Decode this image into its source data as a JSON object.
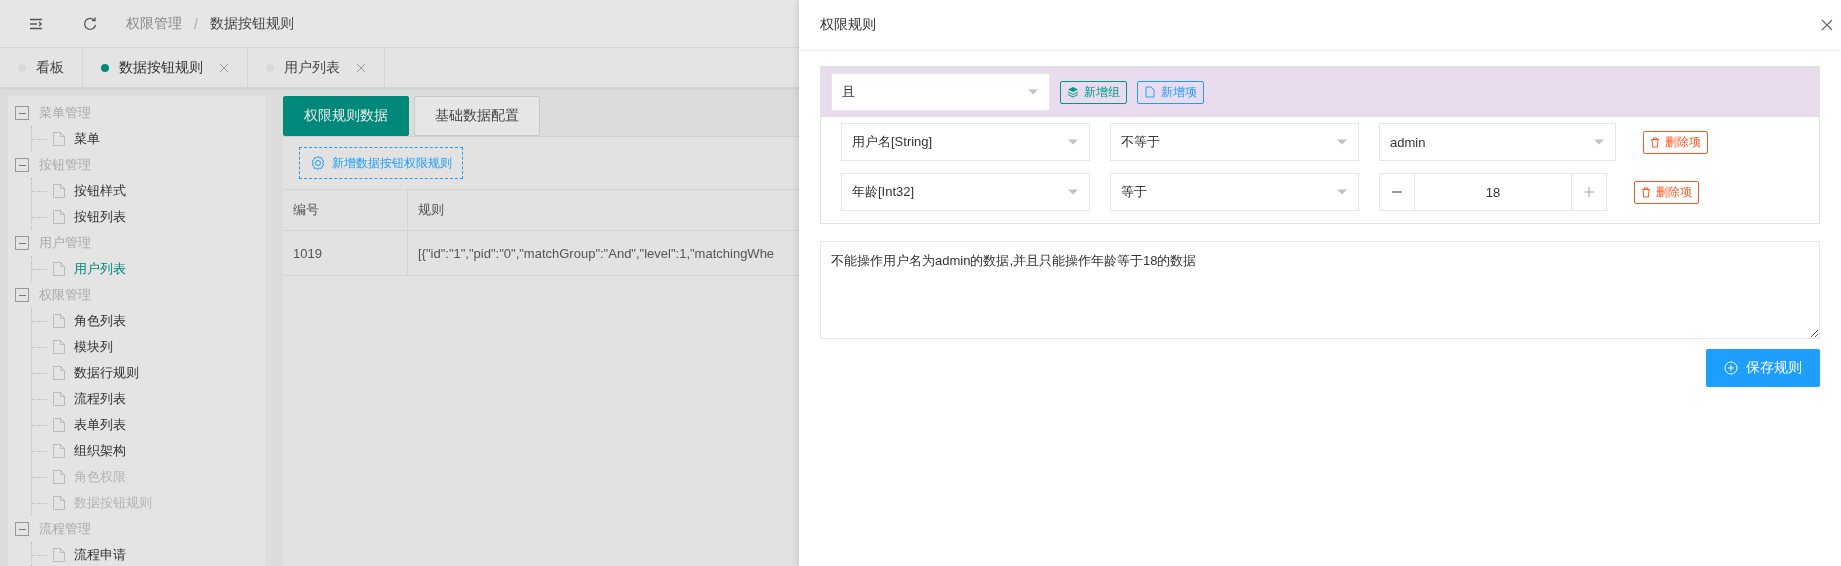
{
  "header": {
    "breadcrumb": [
      {
        "label": "权限管理",
        "current": false
      },
      {
        "label": "数据按钮规则",
        "current": true
      }
    ],
    "separator": "/"
  },
  "tabs": [
    {
      "label": "看板",
      "selected": false,
      "closable": false
    },
    {
      "label": "数据按钮规则",
      "selected": true,
      "closable": true
    },
    {
      "label": "用户列表",
      "selected": false,
      "closable": true
    }
  ],
  "sidebar": {
    "tree": [
      {
        "label": "菜单管理",
        "expanded": true,
        "children": [
          {
            "label": "菜单",
            "selected": false,
            "disabled": false
          }
        ]
      },
      {
        "label": "按钮管理",
        "expanded": true,
        "children": [
          {
            "label": "按钮样式",
            "selected": false,
            "disabled": false
          },
          {
            "label": "按钮列表",
            "selected": false,
            "disabled": false
          }
        ]
      },
      {
        "label": "用户管理",
        "expanded": true,
        "children": [
          {
            "label": "用户列表",
            "selected": true,
            "disabled": false
          }
        ]
      },
      {
        "label": "权限管理",
        "expanded": true,
        "children": [
          {
            "label": "角色列表",
            "selected": false,
            "disabled": false
          },
          {
            "label": "模块列",
            "selected": false,
            "disabled": false
          },
          {
            "label": "数据行规则",
            "selected": false,
            "disabled": false
          },
          {
            "label": "流程列表",
            "selected": false,
            "disabled": false
          },
          {
            "label": "表单列表",
            "selected": false,
            "disabled": false
          },
          {
            "label": "组织架构",
            "selected": false,
            "disabled": false
          },
          {
            "label": "角色权限",
            "selected": false,
            "disabled": true
          },
          {
            "label": "数据按钮规则",
            "selected": false,
            "disabled": true
          }
        ]
      },
      {
        "label": "流程管理",
        "expanded": true,
        "children": [
          {
            "label": "流程申请",
            "selected": false,
            "disabled": false
          }
        ]
      }
    ]
  },
  "content": {
    "view_tabs": [
      {
        "label": "权限规则数据",
        "selected": true
      },
      {
        "label": "基础数据配置",
        "selected": false
      }
    ],
    "add_button": "新增数据按钮权限规则",
    "table": {
      "columns": [
        "编号",
        "规则"
      ],
      "rows": [
        [
          "1019",
          "[{\"id\":\"1\",\"pid\":\"0\",\"matchGroup\":\"And\",\"level\":1,\"matchingWhe"
        ]
      ]
    }
  },
  "drawer": {
    "title": "权限规则",
    "group": {
      "logic": "且",
      "add_group": "新增组",
      "add_item": "新增项",
      "conditions": [
        {
          "field": "用户名[String]",
          "operator": "不等于",
          "kind": "select",
          "value": "admin",
          "delete": "删除项"
        },
        {
          "field": "年龄[Int32]",
          "operator": "等于",
          "kind": "number",
          "value": "18",
          "delete": "删除项"
        }
      ]
    },
    "description": "不能操作用户名为admin的数据,并且只能操作年龄等于18的数据",
    "save": "保存规则"
  }
}
